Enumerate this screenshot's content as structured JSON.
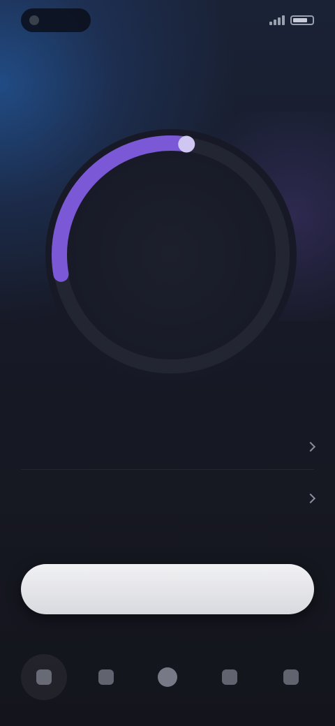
{
  "status_bar": {
    "time": ""
  },
  "header": {
    "title": "",
    "subtitle": ""
  },
  "dial": {
    "progress": 0.3,
    "accent_color": "#7b59d6",
    "labels": {
      "top": "",
      "left": "",
      "right": "",
      "bottom": ""
    }
  },
  "settings": [
    {
      "label": "",
      "value": ""
    },
    {
      "label": "",
      "value": ""
    }
  ],
  "primary_action": {
    "label": ""
  },
  "nav": {
    "items": [
      {
        "icon": "nav-icon-1"
      },
      {
        "icon": "nav-icon-2"
      },
      {
        "icon": "nav-icon-center"
      },
      {
        "icon": "nav-icon-4"
      },
      {
        "icon": "nav-icon-5"
      }
    ]
  }
}
